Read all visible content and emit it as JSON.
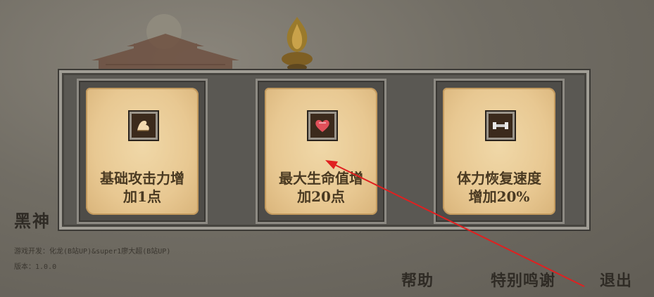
{
  "game": {
    "title": "黑神",
    "credit": "游戏开发：化龙(B站UP)&super1廖大超(B站UP)",
    "version": "版本：1.0.0"
  },
  "upgrades": [
    {
      "icon": "arm-strength-icon",
      "line1": "基础攻击力增",
      "line2": "加1点"
    },
    {
      "icon": "heart-icon",
      "line1": "最大生命值增",
      "line2": "加20点"
    },
    {
      "icon": "dumbbell-icon",
      "line1": "体力恢复速度",
      "line2": "增加20%"
    }
  ],
  "menu": {
    "help": "帮助",
    "thanks": "特别鸣谢",
    "exit": "退出"
  },
  "colors": {
    "card": "#e8c892",
    "text": "#4a3a22",
    "annotation_arrow": "#e02020"
  }
}
